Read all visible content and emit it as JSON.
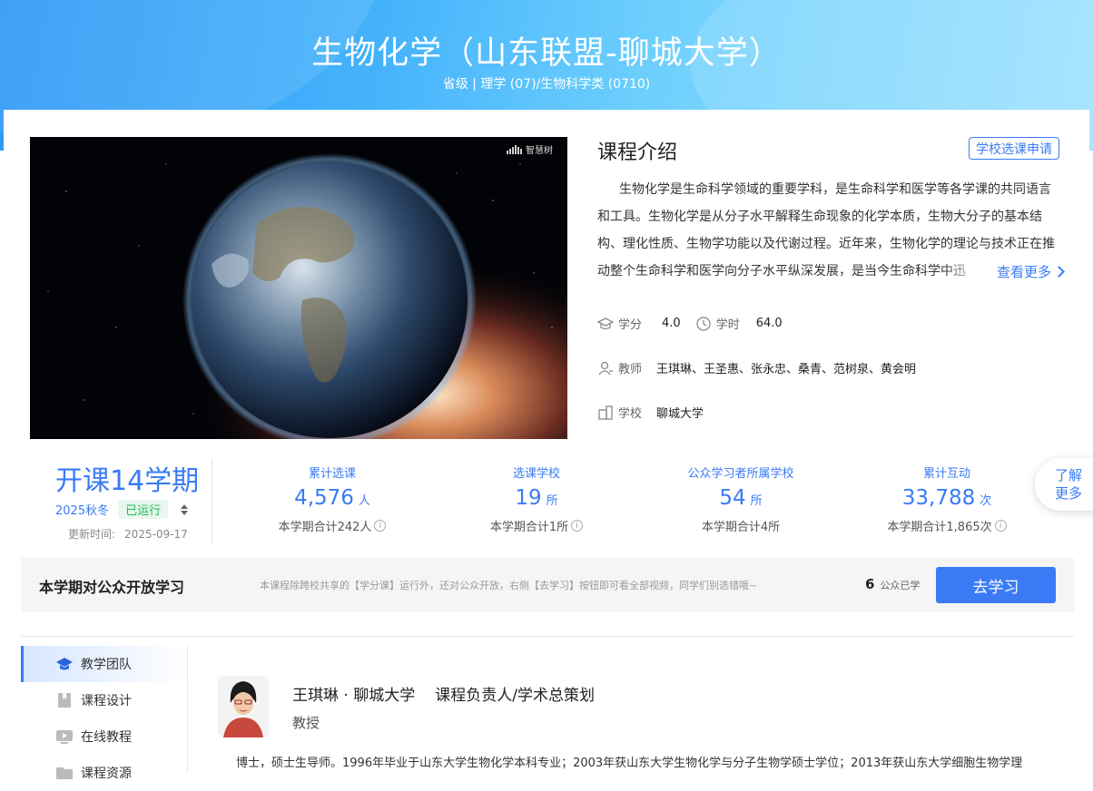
{
  "header": {
    "title": "生物化学（山东联盟-聊城大学）",
    "subtitle": "省级 | 理学 (07)/生物科学类 (0710)"
  },
  "video": {
    "watermark": "智慧树"
  },
  "intro": {
    "title": "课程介绍",
    "apply_button": "学校选课申请",
    "text": "生物化学是生命科学领域的重要学科，是生命科学和医学等各学课的共同语言和工具。生物化学是从分子水平解释生命现象的化学本质，生物大分子的基本结构、理化性质、生物学功能以及代谢过程。近年来，生物化学的理论与技术正在推动整个生命科学和医学向分子水平纵深发展，是当今生命科学中迅",
    "more": "查看更多"
  },
  "meta": {
    "credit_label": "学分",
    "credit_value": "4.0",
    "hours_label": "学时",
    "hours_value": "64.0",
    "teacher_label": "教师",
    "teacher_value": "王琪琳、王圣惠、张永忠、桑青、范树泉、黄会明",
    "school_label": "学校",
    "school_value": "聊城大学"
  },
  "term": {
    "title": "开课14学期",
    "season": "2025秋冬",
    "status": "已运行",
    "updated_label": "更新时间:",
    "updated_value": "2025-09-17"
  },
  "stats": [
    {
      "label": "累计选课",
      "value": "4,576",
      "unit": "人",
      "total": "本学期合计242人"
    },
    {
      "label": "选课学校",
      "value": "19",
      "unit": "所",
      "total": "本学期合计1所"
    },
    {
      "label": "公众学习者所属学校",
      "value": "54",
      "unit": "所",
      "total": "本学期合计4所"
    },
    {
      "label": "累计互动",
      "value": "33,788",
      "unit": "次",
      "total": "本学期合计1,865次"
    }
  ],
  "float_more": {
    "line1": "了解",
    "line2": "更多"
  },
  "public": {
    "title": "本学期对公众开放学习",
    "desc": "本课程除跨校共享的【学分课】运行外，还对公众开放，右侧【去学习】按钮即可看全部视频，同学们别选错哦~",
    "count": "6",
    "count_label": "公众已学",
    "button": "去学习"
  },
  "nav": [
    {
      "label": "教学团队",
      "icon": "graduation-cap-icon"
    },
    {
      "label": "课程设计",
      "icon": "bookmark-icon"
    },
    {
      "label": "在线教程",
      "icon": "video-play-icon"
    },
    {
      "label": "课程资源",
      "icon": "folder-icon"
    }
  ],
  "teacher": {
    "name": "王琪琳 · 聊城大学",
    "role": "课程负责人/学术总策划",
    "title": "教授",
    "bio": "博士，硕士生导师。1996年毕业于山东大学生物化学本科专业；2003年获山东大学生物化学与分子生物学硕士学位；2013年获山东大学细胞生物学理"
  },
  "colors": {
    "accent": "#3a7bf5",
    "status_green": "#23b559",
    "hero_start": "#2a97f5",
    "hero_end": "#9ae1fe"
  }
}
